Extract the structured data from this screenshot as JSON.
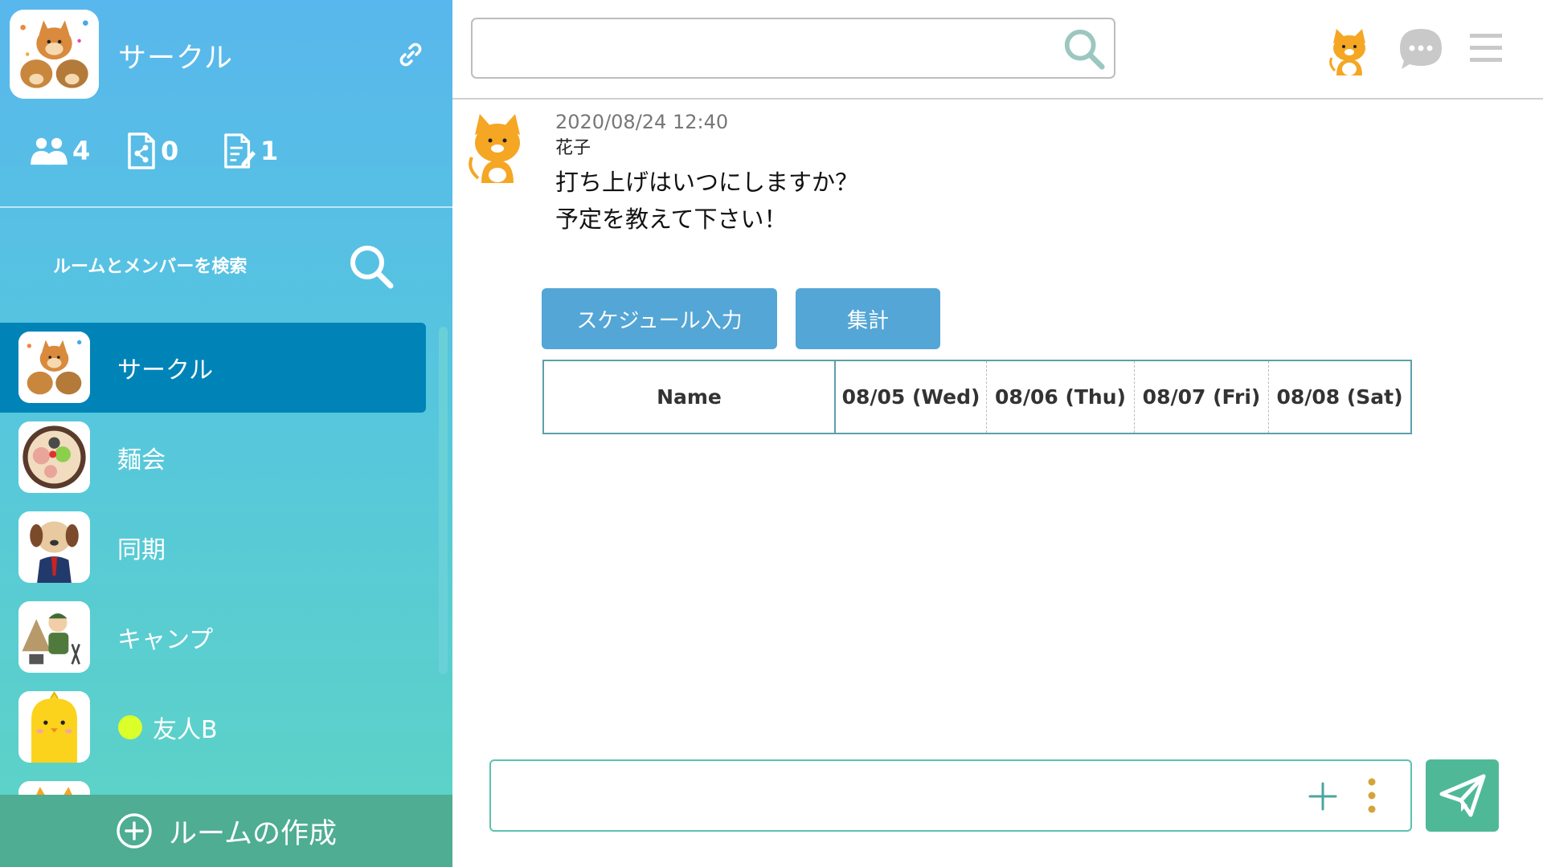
{
  "sidebar": {
    "circle_name": "サークル",
    "stats": {
      "members": "4",
      "files": "0",
      "notes": "1"
    },
    "search_label": "ルームとメンバーを検索",
    "rooms": [
      {
        "label": "サークル",
        "avatar": "party-animals",
        "active": true
      },
      {
        "label": "麺会",
        "avatar": "ramen-bowl",
        "active": false
      },
      {
        "label": "同期",
        "avatar": "dog-businessman",
        "active": false
      },
      {
        "label": "キャンプ",
        "avatar": "camping-soldier",
        "active": false
      },
      {
        "label": "友人B",
        "avatar": "chick",
        "online": true,
        "active": false
      }
    ],
    "create_room_label": "ルームの作成"
  },
  "topbar": {
    "search_value": "",
    "search_placeholder": ""
  },
  "message": {
    "timestamp": "2020/08/24 12:40",
    "author": "花子",
    "lines": [
      "打ち上げはいつにしますか？",
      "予定を教えて下さい！"
    ],
    "buttons": {
      "schedule": "スケジュール入力",
      "total": "集計"
    },
    "schedule_table": {
      "headers": [
        "Name",
        "08/05 (Wed)",
        "08/06 (Thu)",
        "08/07 (Fri)",
        "08/08 (Sat)"
      ]
    }
  },
  "composer": {
    "value": "",
    "placeholder": ""
  },
  "colors": {
    "sidebar_top": "#58b7ec",
    "sidebar_bottom": "#5dd4c4",
    "active_room": "#0084b7",
    "button": "#54a6d6",
    "create_room_bar": "#4ead93",
    "send_button": "#4fb997",
    "online_dot": "#dbff28"
  },
  "icons": [
    "link-icon",
    "members-icon",
    "file-share-icon",
    "note-edit-icon",
    "search-icon",
    "cat-avatar-icon",
    "chat-bubble-icon",
    "hamburger-menu-icon",
    "plus-icon",
    "more-vertical-icon",
    "send-icon",
    "plus-circle-icon"
  ]
}
